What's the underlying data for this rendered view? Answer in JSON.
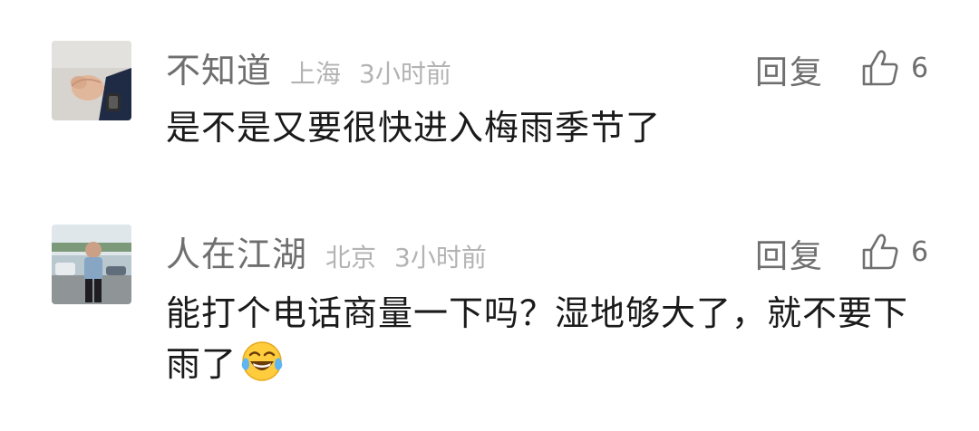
{
  "comments": [
    {
      "user": "不知道",
      "location": "上海",
      "time": "3小时前",
      "reply_label": "回复",
      "likes": "6",
      "text": "是不是又要很快进入梅雨季节了",
      "avatar_icon": "hands-photo-avatar"
    },
    {
      "user": "人在江湖",
      "location": "北京",
      "time": "3小时前",
      "reply_label": "回复",
      "likes": "6",
      "text": "能打个电话商量一下吗？湿地够大了，就不要下雨了",
      "emoji": "tears-of-joy-emoji",
      "avatar_icon": "person-photo-avatar"
    }
  ],
  "colors": {
    "name": "#6f6f6f",
    "meta": "#b3b3b3",
    "text": "#1a1a1a",
    "background": "#ffffff"
  }
}
